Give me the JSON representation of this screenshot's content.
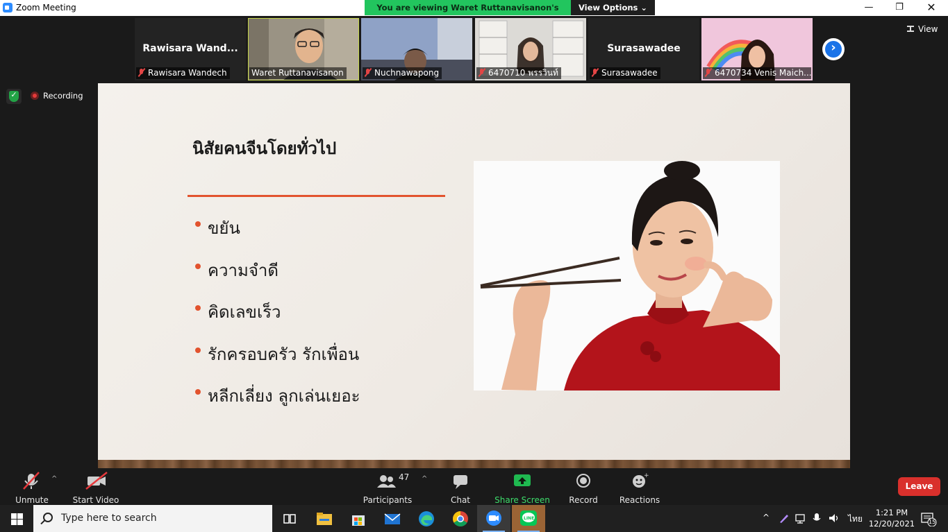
{
  "window": {
    "title": "Zoom Meeting"
  },
  "banner": {
    "viewing": "You are viewing Waret Ruttanavisanon's screen",
    "view_options": "View Options"
  },
  "strip": {
    "view_label": "View",
    "tiles": [
      {
        "big_name": "Rawisara  Wand...",
        "name": "Rawisara Wandech",
        "muted": true
      },
      {
        "big_name": "",
        "name": "Waret Ruttanavisanon",
        "muted": false,
        "active": true
      },
      {
        "big_name": "",
        "name": "Nuchnawapong",
        "muted": true
      },
      {
        "big_name": "",
        "name": "6470710 พรรวินท์",
        "muted": true
      },
      {
        "big_name": "Surasawadee",
        "name": "Surasawadee",
        "muted": true
      },
      {
        "big_name": "",
        "name": "6470734 Venis Maich...",
        "muted": true
      }
    ]
  },
  "status": {
    "recording": "Recording"
  },
  "slide": {
    "title": "นิสัยคนจีนโดยทั่วไป",
    "bullets": [
      "ขยัน",
      "ความจำดี",
      "คิดเลขเร็ว",
      "รักครอบครัว รักเพื่อน",
      "หลีกเลี่ยง ลูกเล่นเยอะ"
    ],
    "image": "woman-with-chopsticks-photo",
    "accent_color": "#e2532e"
  },
  "toolbar": {
    "unmute": "Unmute",
    "start_video": "Start Video",
    "participants": "Participants",
    "participants_count": "47",
    "chat": "Chat",
    "share_screen": "Share Screen",
    "record": "Record",
    "reactions": "Reactions",
    "leave": "Leave"
  },
  "taskbar": {
    "search_placeholder": "Type here to search",
    "language": "ไทย",
    "time": "1:21 PM",
    "date": "12/20/2021",
    "notifications": "15"
  }
}
